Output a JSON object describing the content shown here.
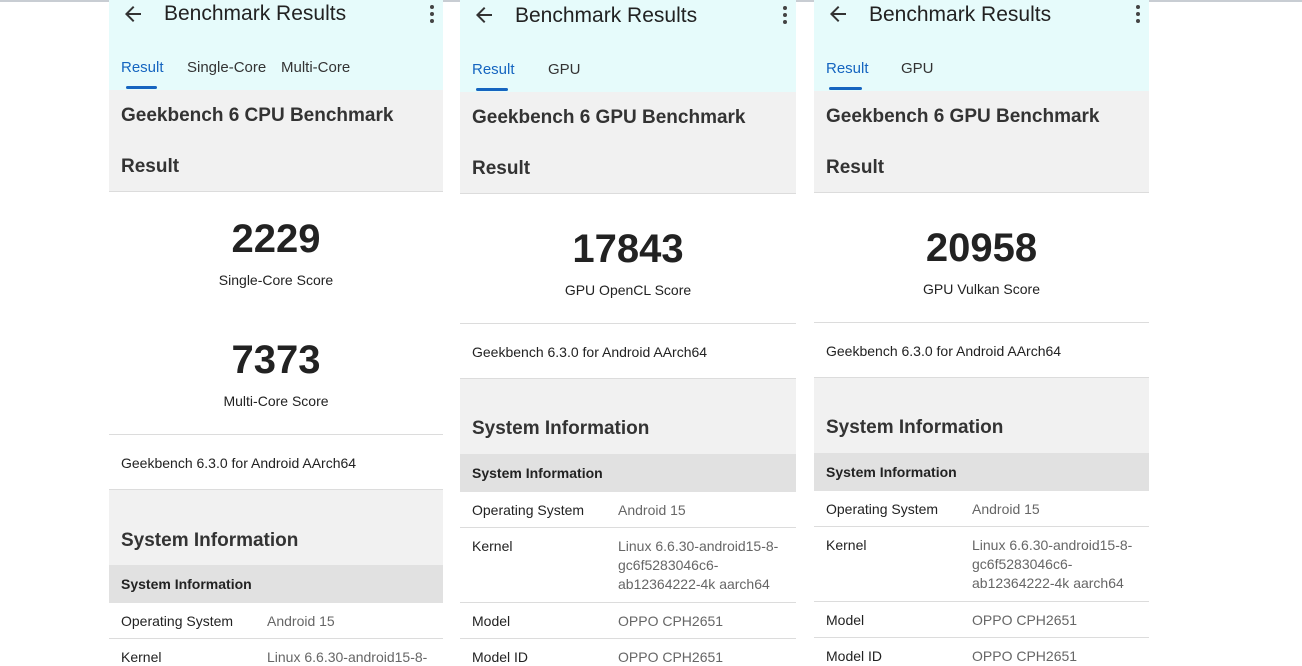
{
  "panels": [
    {
      "app_title": "Benchmark Results",
      "tabs": [
        "Result",
        "Single-Core",
        "Multi-Core"
      ],
      "header_title": "Geekbench 6 CPU Benchmark",
      "header_subtitle": "Result",
      "scores": [
        {
          "value": "2229",
          "label": "Single-Core Score"
        },
        {
          "value": "7373",
          "label": "Multi-Core Score"
        }
      ],
      "version": "Geekbench 6.3.0 for Android AArch64",
      "system_title": "System Information",
      "system_subheader": "System Information",
      "rows": [
        {
          "key": "Operating System",
          "value": [
            "Android 15"
          ]
        },
        {
          "key": "Kernel",
          "value": [
            "Linux 6.6.30-android15-8-"
          ]
        }
      ]
    },
    {
      "app_title": "Benchmark Results",
      "tabs": [
        "Result",
        "GPU"
      ],
      "header_title": "Geekbench 6 GPU Benchmark",
      "header_subtitle": "Result",
      "scores": [
        {
          "value": "17843",
          "label": "GPU OpenCL Score"
        }
      ],
      "version": "Geekbench 6.3.0 for Android AArch64",
      "system_title": "System Information",
      "system_subheader": "System Information",
      "rows": [
        {
          "key": "Operating System",
          "value": [
            "Android 15"
          ]
        },
        {
          "key": "Kernel",
          "value": [
            "Linux 6.6.30-android15-8-",
            "gc6f5283046c6-",
            "ab12364222-4k aarch64"
          ]
        },
        {
          "key": "Model",
          "value": [
            "OPPO CPH2651"
          ]
        },
        {
          "key": "Model ID",
          "value": [
            "OPPO CPH2651"
          ]
        }
      ]
    },
    {
      "app_title": "Benchmark Results",
      "tabs": [
        "Result",
        "GPU"
      ],
      "header_title": "Geekbench 6 GPU Benchmark",
      "header_subtitle": "Result",
      "scores": [
        {
          "value": "20958",
          "label": "GPU Vulkan Score"
        }
      ],
      "version": "Geekbench 6.3.0 for Android AArch64",
      "system_title": "System Information",
      "system_subheader": "System Information",
      "rows": [
        {
          "key": "Operating System",
          "value": [
            "Android 15"
          ]
        },
        {
          "key": "Kernel",
          "value": [
            "Linux 6.6.30-android15-8-",
            "gc6f5283046c6-",
            "ab12364222-4k aarch64"
          ]
        },
        {
          "key": "Model",
          "value": [
            "OPPO CPH2651"
          ]
        },
        {
          "key": "Model ID",
          "value": [
            "OPPO CPH2651"
          ]
        }
      ]
    }
  ],
  "icons": {
    "back": "arrow-left-icon",
    "menu": "more-vert-icon"
  },
  "colors": {
    "appbar": "#e6fbfb",
    "accent": "#1565c0",
    "section": "#f1f1f1",
    "subheader": "#e1e1e1"
  }
}
